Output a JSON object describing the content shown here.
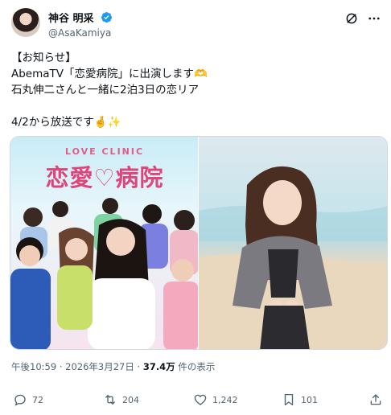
{
  "user": {
    "display_name": "神谷 明采",
    "handle": "@AsaKamiya"
  },
  "tweet": {
    "lines": [
      "【お知らせ】",
      "AbemaTV「恋愛病院」に出演します🫶",
      "石丸伸二さんと一緒に2泊3日の恋リア",
      "",
      "4/2から放送です🤞✨"
    ]
  },
  "media": {
    "left_image_text_small": "LOVE CLINIC",
    "left_image_text_title": "恋愛♡病院"
  },
  "meta": {
    "time": "午後10:59",
    "separator": "·",
    "date": "2026年3月27日",
    "views_count": "37.4万",
    "views_label": "件の表示"
  },
  "actions": {
    "replies": "72",
    "reposts": "204",
    "likes": "1,242",
    "bookmarks": "101"
  },
  "colors": {
    "verified": "#1d9bf0",
    "text": "#0f1419",
    "muted": "#536471"
  }
}
